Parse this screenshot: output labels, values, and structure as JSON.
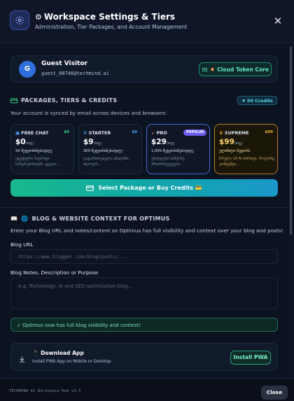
{
  "header": {
    "title": "Workspace Settings & Tiers",
    "subtitle": "Administration, Tier Packages, and Account Management",
    "icon": "gear-icon",
    "close_glyph": "✕"
  },
  "user": {
    "avatar_letter": "G",
    "name": "Guest Visitor",
    "email": "guest_88746@techmind.ai",
    "token_button": "Cloud Token Core"
  },
  "packages": {
    "heading": "PACKAGES, TIERS & CREDITS",
    "credits_badge": "50 Credits",
    "sync_text": "Your account is synced by email across devices and browsers:",
    "tiers": [
      {
        "name": "FREE CHAT",
        "tag": "$0",
        "price": "$0",
        "per": "/თვე",
        "limit": "50 შეტყობინება/დღე",
        "desc": "ეფექტური ჩატბოტი საწყისებისთვის, ყველა..."
      },
      {
        "name": "STARTER",
        "tag": "$9",
        "price": "$9",
        "per": "/თვე",
        "limit": "300 შეტყობინება/დღე",
        "desc": "გაფართოებული ანალიზი, ბლოგის..."
      },
      {
        "name": "PRO",
        "tag": "POPULAR",
        "price": "$29",
        "per": "/თვე",
        "limit": "1,000 შეტყობინება/დღე",
        "desc": "უმაღლესი სიჩქარე, პრიორიტეტული..."
      },
      {
        "name": "SUPREME",
        "tag": "$99",
        "price": "$99",
        "per": "/თვე",
        "limit": "ულიმიტო წვდომა",
        "desc": "სრული 18 AI ბირთვი, როგორც კონტენტი..."
      }
    ],
    "select_button": "Select Package or Buy Credits 💳"
  },
  "blog": {
    "heading": "BLOG & WEBSITE CONTEXT FOR OPTIMUS",
    "intro": "Enter your Blog URL and notes/content so Optimus has full visibility and context over your blog and posts!",
    "url_label": "Blog URL",
    "url_placeholder": "https://www.blogger.com/blog/posts/...",
    "notes_label": "Blog Notes, Description or Purpose",
    "notes_placeholder": "e.g. Technology, AI and SEO optimization blog...",
    "success": "✓ Optimus now has full blog visibility and context!"
  },
  "app": {
    "title": "Download App",
    "subtitle": "Install PWA App on Mobile or Desktop",
    "install_button": "Install PWA"
  },
  "footer": {
    "version": "TECHMIND AI Workspace Hub v3.5",
    "close_button": "Close"
  },
  "colors": {
    "accent_green": "#19b98c",
    "accent_cyan": "#1a98c8",
    "pro_border": "#4a63d6",
    "supreme_border": "#b77d16",
    "free_tag": "#2fd58a",
    "starter_tag": "#4aa3ff",
    "supreme_tag": "#f2b232"
  }
}
